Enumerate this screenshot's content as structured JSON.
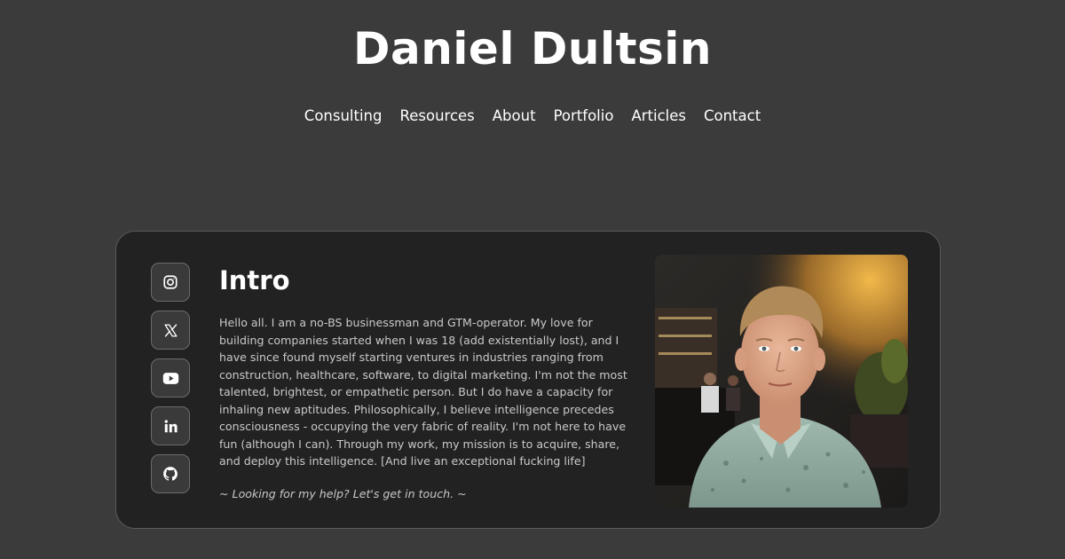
{
  "header": {
    "title": "Daniel Dultsin"
  },
  "nav": {
    "items": [
      "Consulting",
      "Resources",
      "About",
      "Portfolio",
      "Articles",
      "Contact"
    ]
  },
  "socials": [
    {
      "icon": "instagram-icon"
    },
    {
      "icon": "x-twitter-icon"
    },
    {
      "icon": "youtube-icon"
    },
    {
      "icon": "linkedin-icon"
    },
    {
      "icon": "github-icon"
    }
  ],
  "intro": {
    "heading": "Intro",
    "body": "Hello all. I am a no-BS businessman and GTM-operator. My love for building companies started when I was 18 (add existentially lost), and I have since found myself starting ventures in industries ranging from construction, healthcare, software, to digital marketing. I'm not the most talented, brightest, or empathetic person. But I do have a capacity for inhaling new aptitudes. Philosophically, I believe intelligence precedes consciousness - occupying the very fabric of reality. I'm not here to have fun (although I can). Through my work, my mission is to acquire, share, and deploy this intelligence. [And live an exceptional fucking life]",
    "cta": "~ Looking for my help? Let's get in touch. ~"
  },
  "colors": {
    "background": "#3b3b3b",
    "card": "#222222",
    "text": "#ffffff",
    "muted_text": "#c9c9c9"
  }
}
